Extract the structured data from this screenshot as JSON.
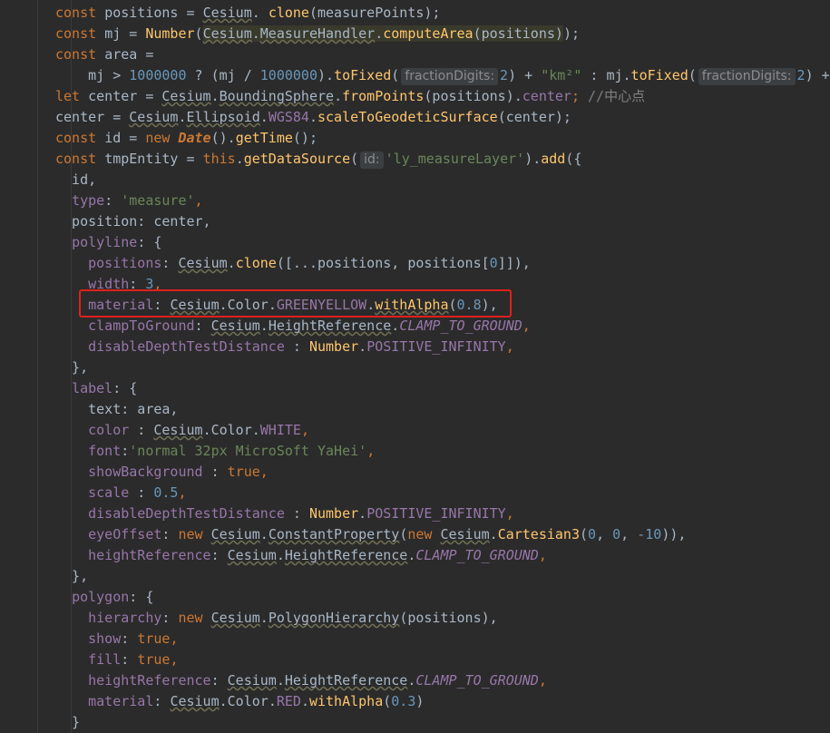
{
  "editor": {
    "lines": [
      {
        "t": [
          [
            "kw",
            "const "
          ],
          [
            "",
            "positions = "
          ],
          [
            "wavy",
            "Cesium"
          ],
          [
            "",
            ". "
          ],
          [
            "fn",
            "clone"
          ],
          [
            "",
            "(measurePoints);"
          ]
        ]
      },
      {
        "t": [
          [
            "kw",
            "const "
          ],
          [
            "",
            "mj = "
          ],
          [
            "fn",
            "Number"
          ],
          [
            "",
            "("
          ],
          [
            "hlwavy",
            "Cesium"
          ],
          [
            "hl",
            "."
          ],
          [
            "hlwavy",
            "MeasureHandler"
          ],
          [
            "hl",
            "."
          ],
          [
            "hlfn",
            "computeArea"
          ],
          [
            "hl",
            "(positions)"
          ],
          [
            "",
            ");"
          ]
        ]
      },
      {
        "t": [
          [
            "kw",
            "const "
          ],
          [
            "",
            "area ="
          ]
        ]
      },
      {
        "t": [
          [
            "",
            "    mj > "
          ],
          [
            "num",
            "1000000"
          ],
          [
            "",
            " ? (mj / "
          ],
          [
            "num",
            "1000000"
          ],
          [
            "",
            ")."
          ],
          [
            "fn",
            "toFixed"
          ],
          [
            "",
            "("
          ],
          [
            "hint",
            "fractionDigits:"
          ],
          [
            "num",
            "2"
          ],
          [
            "",
            ") + "
          ],
          [
            "str",
            "\"km²\""
          ],
          [
            "",
            " : mj."
          ],
          [
            "fn",
            "toFixed"
          ],
          [
            "",
            "("
          ],
          [
            "hint",
            "fractionDigits:"
          ],
          [
            "num",
            "2"
          ],
          [
            "",
            ") +"
          ]
        ]
      },
      {
        "t": [
          [
            "kw",
            "let "
          ],
          [
            "",
            "center = "
          ],
          [
            "wavy",
            "Cesium"
          ],
          [
            "",
            "."
          ],
          [
            "wavy",
            "BoundingSphere"
          ],
          [
            "",
            "."
          ],
          [
            "fn",
            "fromPoints"
          ],
          [
            "",
            "(positions)."
          ],
          [
            "prop",
            "center"
          ],
          [
            "kw",
            ";"
          ],
          [
            "cmt",
            " //中心点"
          ]
        ]
      },
      {
        "t": [
          [
            "",
            "center = "
          ],
          [
            "wavy",
            "Cesium"
          ],
          [
            "",
            "."
          ],
          [
            "wavy",
            "Ellipsoid"
          ],
          [
            "",
            "."
          ],
          [
            "prop",
            "WGS84"
          ],
          [
            "",
            "."
          ],
          [
            "fn",
            "scaleToGeodeticSurface"
          ],
          [
            "",
            "(center);"
          ]
        ]
      },
      {
        "t": [
          [
            "kw",
            "const "
          ],
          [
            "",
            "id = "
          ],
          [
            "kw",
            "new "
          ],
          [
            "dateKw",
            "Date"
          ],
          [
            "",
            "()."
          ],
          [
            "fn",
            "getTime"
          ],
          [
            "",
            "();"
          ]
        ]
      },
      {
        "t": [
          [
            "kw",
            "const "
          ],
          [
            "",
            "tmpEntity = "
          ],
          [
            "kw",
            "this"
          ],
          [
            "",
            "."
          ],
          [
            "fn",
            "getDataSource"
          ],
          [
            "",
            "("
          ],
          [
            "hint",
            "id:"
          ],
          [
            "str",
            "'ly_measureLayer'"
          ],
          [
            "",
            ")."
          ],
          [
            "fn",
            "add"
          ],
          [
            "",
            "({"
          ]
        ]
      },
      {
        "t": [
          [
            "",
            "  id,"
          ]
        ]
      },
      {
        "t": [
          [
            "",
            "  "
          ],
          [
            "prop",
            "type"
          ],
          [
            "",
            ": "
          ],
          [
            "str",
            "'measure'"
          ],
          [
            "kw",
            ","
          ]
        ]
      },
      {
        "t": [
          [
            "",
            "  position: center,"
          ]
        ]
      },
      {
        "t": [
          [
            "",
            "  "
          ],
          [
            "prop",
            "polyline"
          ],
          [
            "",
            ": {"
          ]
        ]
      },
      {
        "t": [
          [
            "",
            "    "
          ],
          [
            "prop",
            "positions"
          ],
          [
            "",
            ": "
          ],
          [
            "wavy",
            "Cesium"
          ],
          [
            "",
            "."
          ],
          [
            "fn",
            "clone"
          ],
          [
            "",
            "([...positions, positions["
          ],
          [
            "num",
            "0"
          ],
          [
            "",
            "]]),"
          ]
        ]
      },
      {
        "t": [
          [
            "",
            "    "
          ],
          [
            "prop",
            "width"
          ],
          [
            "",
            ": "
          ],
          [
            "num",
            "3"
          ],
          [
            "kw",
            ","
          ]
        ]
      },
      {
        "t": [
          [
            "",
            "    "
          ],
          [
            "prop",
            "material"
          ],
          [
            "",
            ": "
          ],
          [
            "wavy",
            "Cesium"
          ],
          [
            "",
            "."
          ],
          [
            "cls",
            "Color"
          ],
          [
            "",
            "."
          ],
          [
            "prop",
            "GREENYELLOW"
          ],
          [
            "",
            "."
          ],
          [
            "fnwavy",
            "withAlpha"
          ],
          [
            "",
            "("
          ],
          [
            "num",
            "0.8"
          ],
          [
            "",
            "),"
          ]
        ]
      },
      {
        "t": [
          [
            "",
            "    "
          ],
          [
            "prop",
            "clampToGround"
          ],
          [
            "",
            ": "
          ],
          [
            "wavy",
            "Cesium"
          ],
          [
            "",
            "."
          ],
          [
            "wavy",
            "HeightReference"
          ],
          [
            "",
            "."
          ],
          [
            "italprop",
            "CLAMP_TO_GROUND"
          ],
          [
            "kw",
            ","
          ]
        ]
      },
      {
        "t": [
          [
            "",
            "    "
          ],
          [
            "prop",
            "disableDepthTestDistance"
          ],
          [
            "",
            " : "
          ],
          [
            "fn",
            "Number"
          ],
          [
            "",
            "."
          ],
          [
            "prop",
            "POSITIVE_INFINITY"
          ],
          [
            "kw",
            ","
          ]
        ]
      },
      {
        "t": [
          [
            "",
            "  },"
          ]
        ]
      },
      {
        "t": [
          [
            "",
            "  "
          ],
          [
            "prop",
            "label"
          ],
          [
            "",
            ": {"
          ]
        ]
      },
      {
        "t": [
          [
            "",
            "    text: area,"
          ]
        ]
      },
      {
        "t": [
          [
            "",
            "    "
          ],
          [
            "prop",
            "color"
          ],
          [
            "",
            " : "
          ],
          [
            "wavy",
            "Cesium"
          ],
          [
            "",
            "."
          ],
          [
            "cls",
            "Color"
          ],
          [
            "",
            "."
          ],
          [
            "prop",
            "WHITE"
          ],
          [
            "kw",
            ","
          ]
        ]
      },
      {
        "t": [
          [
            "",
            "    "
          ],
          [
            "prop",
            "font"
          ],
          [
            "",
            ":"
          ],
          [
            "str",
            "'normal 32px MicroSoft YaHei'"
          ],
          [
            "kw",
            ","
          ]
        ]
      },
      {
        "t": [
          [
            "",
            "    "
          ],
          [
            "prop",
            "showBackground"
          ],
          [
            "",
            " : "
          ],
          [
            "kw",
            "true"
          ],
          [
            "kw",
            ","
          ]
        ]
      },
      {
        "t": [
          [
            "",
            "    "
          ],
          [
            "prop",
            "scale"
          ],
          [
            "",
            " : "
          ],
          [
            "num",
            "0.5"
          ],
          [
            "kw",
            ","
          ]
        ]
      },
      {
        "t": [
          [
            "",
            "    "
          ],
          [
            "prop",
            "disableDepthTestDistance"
          ],
          [
            "",
            " : "
          ],
          [
            "fn",
            "Number"
          ],
          [
            "",
            "."
          ],
          [
            "prop",
            "POSITIVE_INFINITY"
          ],
          [
            "kw",
            ","
          ]
        ]
      },
      {
        "t": [
          [
            "",
            "    "
          ],
          [
            "prop",
            "eyeOffset"
          ],
          [
            "",
            ": "
          ],
          [
            "kw",
            "new "
          ],
          [
            "wavy",
            "Cesium"
          ],
          [
            "",
            "."
          ],
          [
            "wavy",
            "ConstantProperty"
          ],
          [
            "",
            "("
          ],
          [
            "kw",
            "new "
          ],
          [
            "wavy",
            "Cesium"
          ],
          [
            "",
            "."
          ],
          [
            "fn",
            "Cartesian3"
          ],
          [
            "",
            "("
          ],
          [
            "num",
            "0"
          ],
          [
            "",
            ", "
          ],
          [
            "num",
            "0"
          ],
          [
            "",
            ", "
          ],
          [
            "num",
            "-10"
          ],
          [
            "",
            ")),"
          ]
        ]
      },
      {
        "t": [
          [
            "",
            "    "
          ],
          [
            "prop",
            "heightReference"
          ],
          [
            "",
            ": "
          ],
          [
            "wavy",
            "Cesium"
          ],
          [
            "",
            "."
          ],
          [
            "wavy",
            "HeightReference"
          ],
          [
            "",
            "."
          ],
          [
            "italprop",
            "CLAMP_TO_GROUND"
          ],
          [
            "kw",
            ","
          ]
        ]
      },
      {
        "t": [
          [
            "",
            "  },"
          ]
        ]
      },
      {
        "t": [
          [
            "",
            "  "
          ],
          [
            "prop",
            "polygon"
          ],
          [
            "",
            ": {"
          ]
        ]
      },
      {
        "t": [
          [
            "",
            "    "
          ],
          [
            "prop",
            "hierarchy"
          ],
          [
            "",
            ": "
          ],
          [
            "kw",
            "new "
          ],
          [
            "wavy",
            "Cesium"
          ],
          [
            "",
            "."
          ],
          [
            "wavy",
            "PolygonHierarchy"
          ],
          [
            "",
            "(positions),"
          ]
        ]
      },
      {
        "t": [
          [
            "",
            "    "
          ],
          [
            "prop",
            "show"
          ],
          [
            "",
            ": "
          ],
          [
            "kw",
            "true"
          ],
          [
            "kw",
            ","
          ]
        ]
      },
      {
        "t": [
          [
            "",
            "    "
          ],
          [
            "prop",
            "fill"
          ],
          [
            "",
            ": "
          ],
          [
            "kw",
            "true"
          ],
          [
            "kw",
            ","
          ]
        ]
      },
      {
        "t": [
          [
            "",
            "    "
          ],
          [
            "prop",
            "heightReference"
          ],
          [
            "",
            ": "
          ],
          [
            "wavy",
            "Cesium"
          ],
          [
            "",
            "."
          ],
          [
            "wavy",
            "HeightReference"
          ],
          [
            "",
            "."
          ],
          [
            "italprop",
            "CLAMP_TO_GROUND"
          ],
          [
            "kw",
            ","
          ]
        ]
      },
      {
        "t": [
          [
            "",
            "    "
          ],
          [
            "prop",
            "material"
          ],
          [
            "",
            ": "
          ],
          [
            "wavy",
            "Cesium"
          ],
          [
            "",
            "."
          ],
          [
            "cls",
            "Color"
          ],
          [
            "",
            "."
          ],
          [
            "prop",
            "RED"
          ],
          [
            "",
            "."
          ],
          [
            "fn",
            "withAlpha"
          ],
          [
            "",
            "("
          ],
          [
            "num",
            "0.3"
          ],
          [
            "",
            ")"
          ]
        ]
      },
      {
        "t": [
          [
            "",
            "  }"
          ]
        ]
      }
    ]
  },
  "colors": {
    "background": "#2b2b2b",
    "keyword": "#cc7832",
    "function": "#ffc66d",
    "property": "#9876aa",
    "string": "#6a8759",
    "number": "#6897bb",
    "comment": "#808080",
    "highlight_box": "#e0201b"
  }
}
